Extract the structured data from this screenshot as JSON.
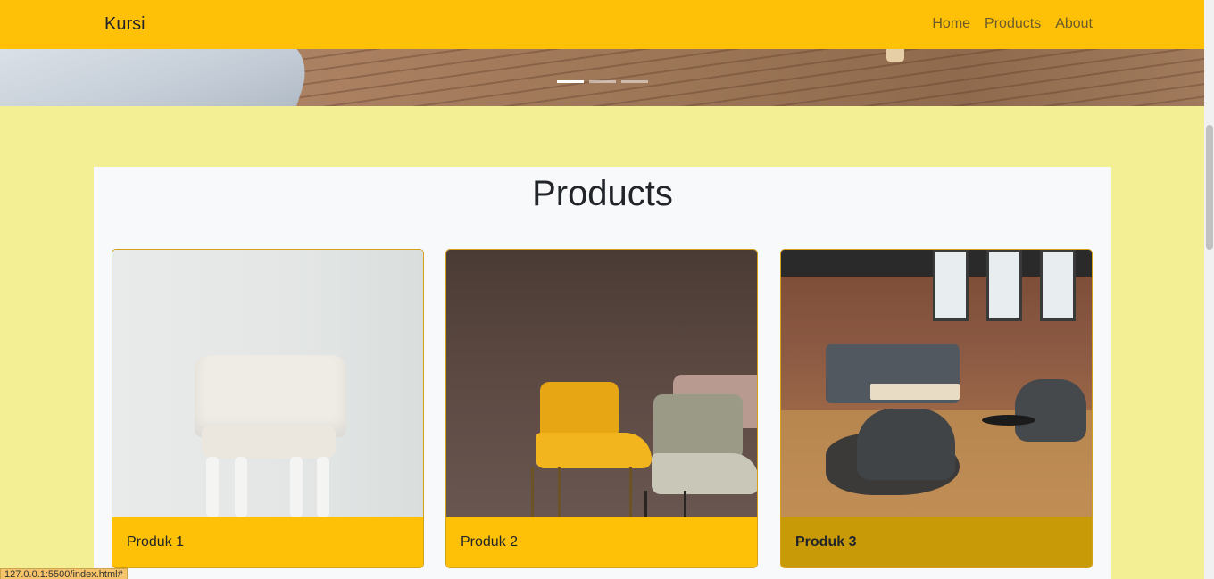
{
  "navbar": {
    "brand": "Kursi",
    "links": [
      "Home",
      "Products",
      "About"
    ]
  },
  "carousel": {
    "indicators": 3,
    "active_index": 0
  },
  "products": {
    "title": "Products",
    "cards": [
      {
        "label": "Produk 1",
        "image": "white-tufted-armchair"
      },
      {
        "label": "Produk 2",
        "image": "yellow-and-grey-chairs"
      },
      {
        "label": "Produk 3",
        "image": "loft-lounge-interior"
      }
    ]
  },
  "status": {
    "url": "127.0.0.1:5500/index.html#"
  },
  "colors": {
    "accent": "#ffc107",
    "page_bg": "#f3ef94",
    "container_bg": "#f8f9fa",
    "card_hover_footer": "#c99a08"
  }
}
